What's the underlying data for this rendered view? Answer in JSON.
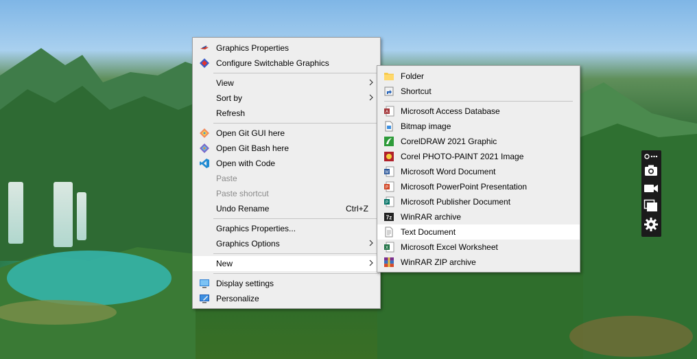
{
  "context_menu": {
    "items": [
      {
        "label": "Graphics Properties",
        "icon": "intel-graphics-icon"
      },
      {
        "label": "Configure Switchable Graphics",
        "icon": "amd-graphics-icon"
      },
      {
        "label": "View",
        "has_submenu": true
      },
      {
        "label": "Sort by",
        "has_submenu": true
      },
      {
        "label": "Refresh"
      },
      {
        "label": "Open Git GUI here",
        "icon": "git-gui-icon"
      },
      {
        "label": "Open Git Bash here",
        "icon": "git-bash-icon"
      },
      {
        "label": "Open with Code",
        "icon": "vscode-icon"
      },
      {
        "label": "Paste",
        "disabled": true
      },
      {
        "label": "Paste shortcut",
        "disabled": true
      },
      {
        "label": "Undo Rename",
        "shortcut": "Ctrl+Z"
      },
      {
        "label": "Graphics Properties..."
      },
      {
        "label": "Graphics Options",
        "has_submenu": true
      },
      {
        "label": "New",
        "has_submenu": true,
        "highlighted": true
      },
      {
        "label": "Display settings",
        "icon": "display-settings-icon"
      },
      {
        "label": "Personalize",
        "icon": "personalize-icon"
      }
    ]
  },
  "new_submenu": {
    "items": [
      {
        "label": "Folder",
        "icon": "folder-icon"
      },
      {
        "label": "Shortcut",
        "icon": "shortcut-icon"
      },
      {
        "label": "Microsoft Access Database",
        "icon": "access-icon"
      },
      {
        "label": "Bitmap image",
        "icon": "bitmap-icon"
      },
      {
        "label": "CorelDRAW 2021 Graphic",
        "icon": "coreldraw-icon"
      },
      {
        "label": "Corel PHOTO-PAINT 2021 Image",
        "icon": "photopaint-icon"
      },
      {
        "label": "Microsoft Word Document",
        "icon": "word-icon"
      },
      {
        "label": "Microsoft PowerPoint Presentation",
        "icon": "powerpoint-icon"
      },
      {
        "label": "Microsoft Publisher Document",
        "icon": "publisher-icon"
      },
      {
        "label": "WinRAR archive",
        "icon": "winrar-7z-icon"
      },
      {
        "label": "Text Document",
        "icon": "text-document-icon",
        "highlighted": true
      },
      {
        "label": "Microsoft Excel Worksheet",
        "icon": "excel-icon"
      },
      {
        "label": "WinRAR ZIP archive",
        "icon": "winrar-zip-icon"
      }
    ]
  },
  "capture_toolbar": {
    "icons": [
      "pin-more-icon",
      "camera-icon",
      "video-camera-icon",
      "window-capture-icon",
      "gear-icon"
    ]
  },
  "colors": {
    "menu_bg": "#eeeeee",
    "menu_border": "#a0a0a0",
    "highlight": "#ffffff",
    "disabled_text": "#8a8a8a",
    "toolbar_bg": "#1b1b1b"
  }
}
